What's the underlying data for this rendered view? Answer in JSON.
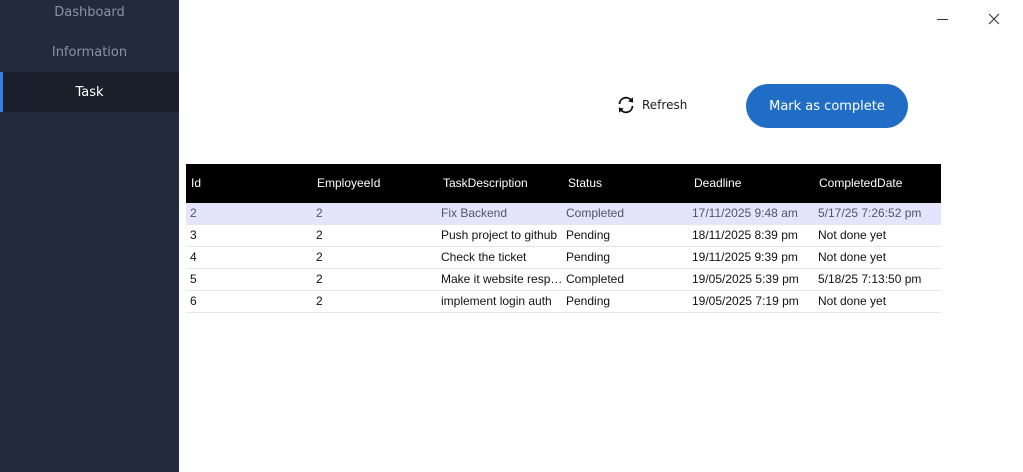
{
  "sidebar": {
    "items": [
      {
        "label": "Dashboard"
      },
      {
        "label": "Information"
      },
      {
        "label": "Task"
      }
    ],
    "active": "Task",
    "background": "#222b3b",
    "accent": "#3d7be5"
  },
  "window_controls": {
    "minimize_icon": "minimize-icon",
    "close_icon": "close-icon"
  },
  "toolbar": {
    "refresh_label": "Refresh",
    "refresh_icon": "refresh-icon",
    "mark_complete_label": "Mark as complete",
    "mark_complete_color": "#1f6dc5"
  },
  "grid": {
    "columns": [
      "Id",
      "EmployeeId",
      "TaskDescription",
      "Status",
      "Deadline",
      "CompletedDate"
    ],
    "rows": [
      [
        "2",
        "2",
        "Fix Backend",
        "Completed",
        "17/11/2025 9:48 am",
        "5/17/25 7:26:52 pm"
      ],
      [
        "3",
        "2",
        "Push project to github",
        "Pending",
        "18/11/2025 8:39 pm",
        "Not done yet"
      ],
      [
        "4",
        "2",
        "Check the ticket",
        "Pending",
        "19/11/2025 9:39 pm",
        "Not done yet"
      ],
      [
        "5",
        "2",
        "Make it website respon...",
        "Completed",
        "19/05/2025 5:39 pm",
        "5/18/25 7:13:50 pm"
      ],
      [
        "6",
        "2",
        "implement login auth",
        "Pending",
        "19/05/2025 7:19 pm",
        "Not done yet"
      ]
    ],
    "selected_row": 0,
    "header_color": "#000000",
    "selected_color": "#e4e4fb"
  }
}
